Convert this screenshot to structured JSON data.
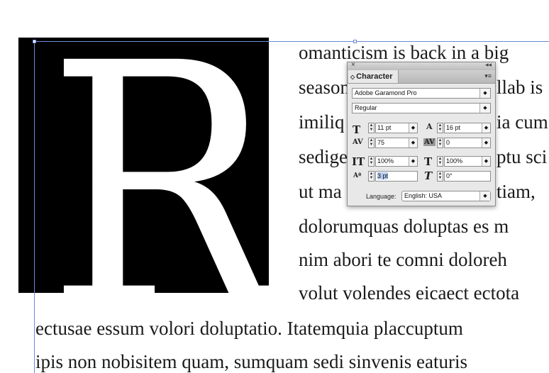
{
  "document": {
    "dropcap_letter": "R",
    "lines": [
      "omanticism is back in a big",
      "season",
      "llab is",
      "imiliq",
      "ia cum",
      "sedige",
      "ptu sci",
      "ut ma",
      "tiam,",
      "dolorumquas doluptas es m",
      "nim abori te comni doloreh",
      "volut volendes eicaect ectota",
      "ectusae essum volori doluptatio. Itatemquia placcuptum",
      "ipis non nobisitem quam, sumquam sedi sinvenis eaturis"
    ]
  },
  "panel": {
    "close_glyph": "×",
    "collapse_glyph": "◂◂",
    "tab_label": "Character",
    "tab_arrows": "◇",
    "menu_glyph": "▾≡",
    "font_family": "Adobe Garamond Pro",
    "font_style": "Regular",
    "font_size": "11 pt",
    "leading": "16 pt",
    "kerning": "75",
    "tracking": "0",
    "vertical_scale": "100%",
    "horizontal_scale": "100%",
    "baseline_shift": "3 pt",
    "skew": "0°",
    "language_label": "Language:",
    "language_value": "English: USA",
    "icons": {
      "font_size": "font-size-icon",
      "leading": "leading-icon",
      "kerning": "kerning-icon",
      "tracking": "tracking-icon",
      "vertical_scale": "vertical-scale-icon",
      "horizontal_scale": "horizontal-scale-icon",
      "baseline_shift": "baseline-shift-icon",
      "skew": "skew-icon"
    }
  }
}
